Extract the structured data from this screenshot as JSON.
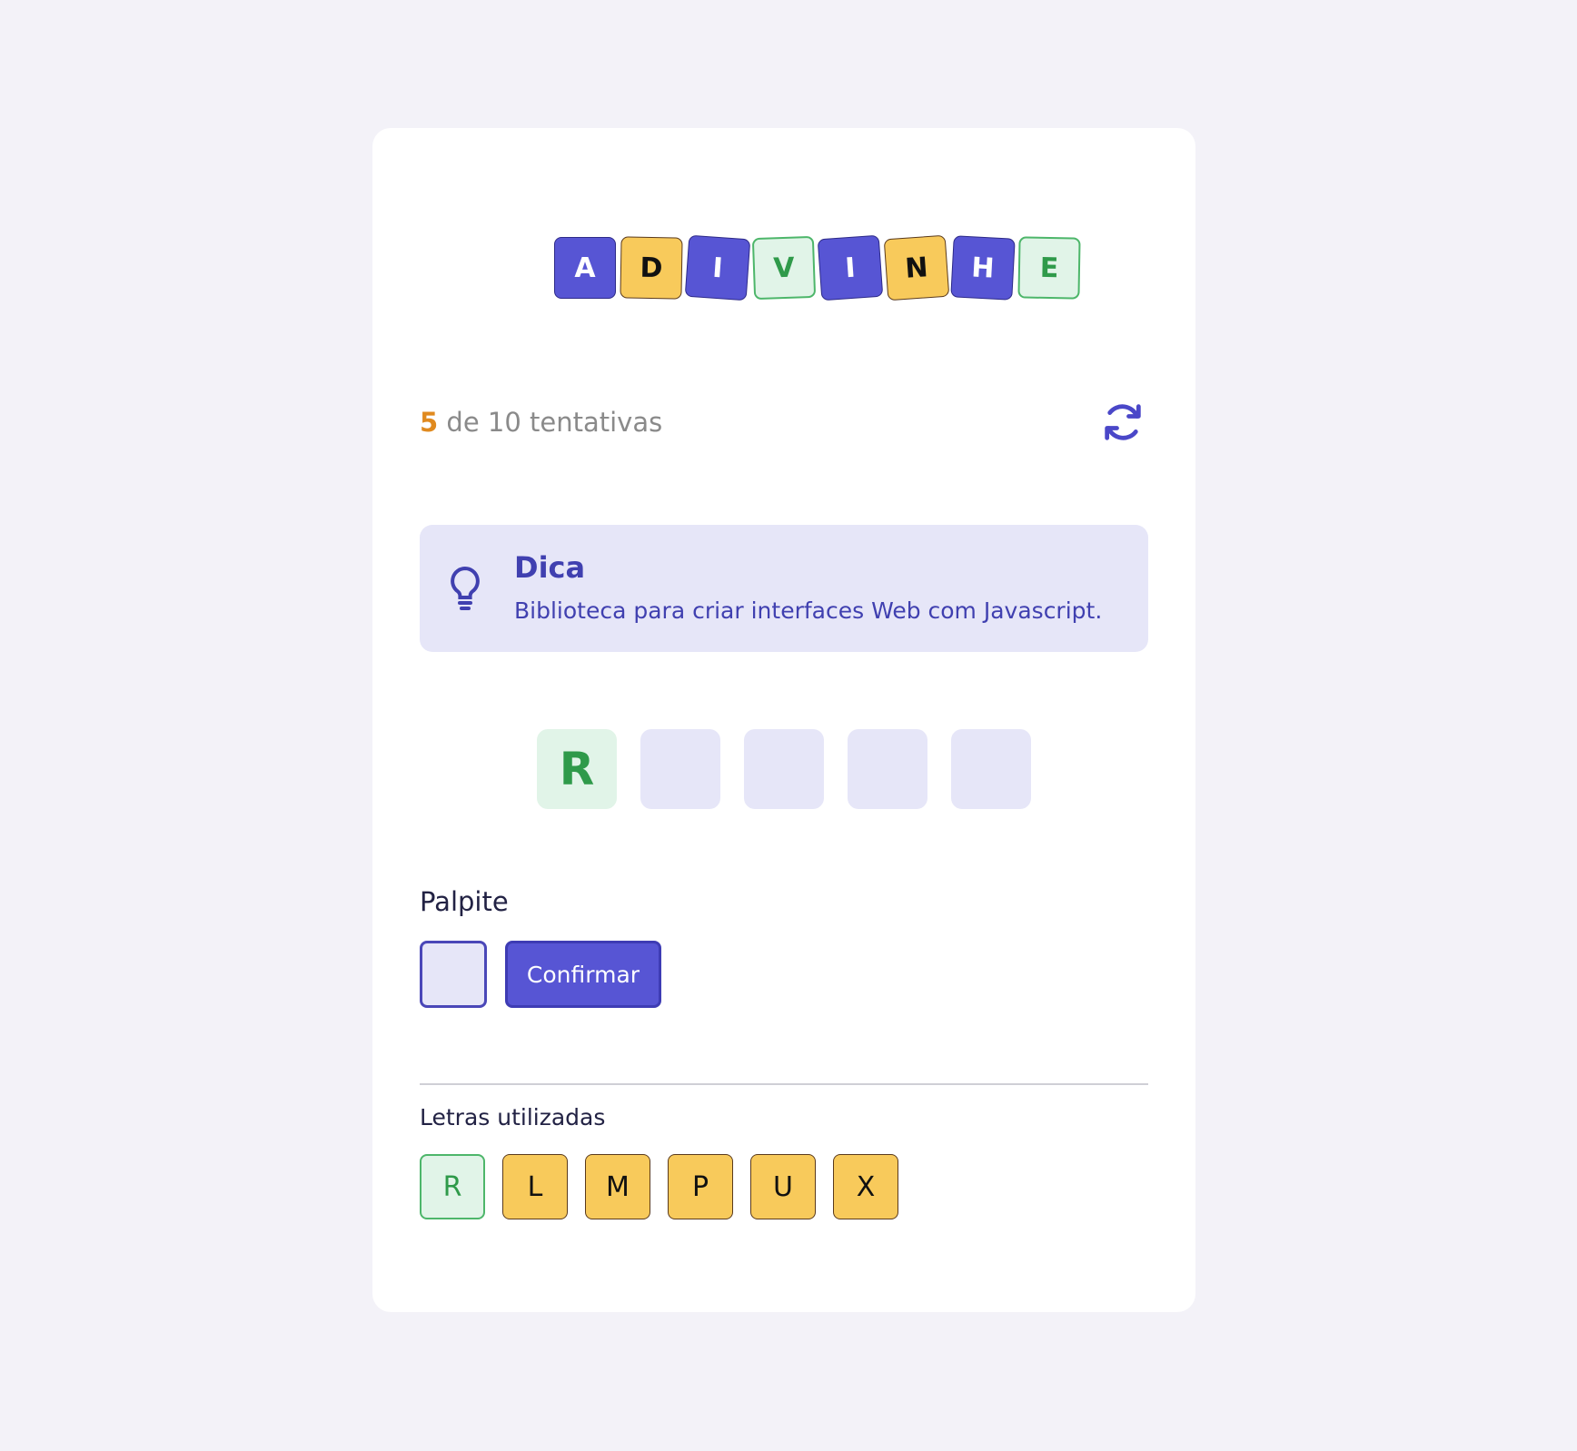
{
  "logo": {
    "letters": [
      {
        "char": "A",
        "style": "purple",
        "rotate": 0
      },
      {
        "char": "D",
        "style": "yellow",
        "rotate": 1
      },
      {
        "char": "I",
        "style": "purple",
        "rotate": 4
      },
      {
        "char": "V",
        "style": "green",
        "rotate": -2
      },
      {
        "char": "I",
        "style": "purple",
        "rotate": -4
      },
      {
        "char": "N",
        "style": "yellow",
        "rotate": -4
      },
      {
        "char": "H",
        "style": "purple",
        "rotate": 3
      },
      {
        "char": "E",
        "style": "green",
        "rotate": 1
      }
    ]
  },
  "attempts": {
    "current": "5",
    "text": "de 10 tentativas"
  },
  "hint": {
    "title": "Dica",
    "text": "Biblioteca para criar interfaces Web com Javascript."
  },
  "word": {
    "slots": [
      "R",
      "",
      "",
      "",
      ""
    ]
  },
  "guess": {
    "label": "Palpite",
    "value": "",
    "confirm_label": "Confirmar"
  },
  "used_letters": {
    "label": "Letras utilizadas",
    "letters": [
      {
        "char": "R",
        "correct": true
      },
      {
        "char": "L",
        "correct": false
      },
      {
        "char": "M",
        "correct": false
      },
      {
        "char": "P",
        "correct": false
      },
      {
        "char": "U",
        "correct": false
      },
      {
        "char": "X",
        "correct": false
      }
    ]
  },
  "colors": {
    "primary": "#5755d4",
    "wrong": "#f8ca5b",
    "correct_bg": "#e1f4e8",
    "correct_text": "#2f9a4a",
    "attempt_count": "#e08a1f"
  },
  "icons": {
    "restart": "refresh-icon",
    "hint": "lightbulb-icon"
  }
}
